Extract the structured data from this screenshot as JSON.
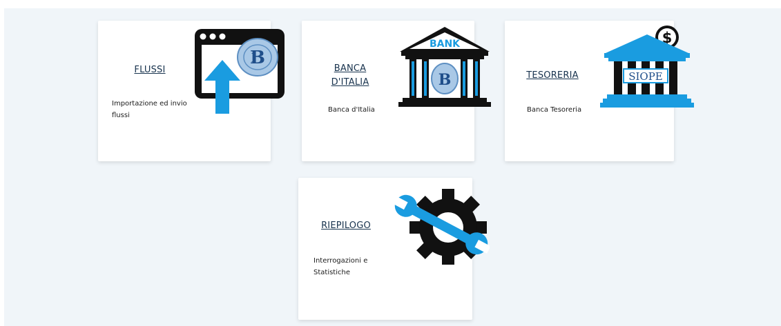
{
  "colors": {
    "accent": "#1a9ce0",
    "icon_dark": "#111111",
    "title": "#17324d",
    "background": "#f0f5f9"
  },
  "cards": [
    {
      "title": "FLUSSI",
      "description": "Importazione ed invio flussi",
      "icon": "upload-window-icon"
    },
    {
      "title": "BANCA D'ITALIA",
      "description": "Banca d'Italia",
      "icon": "bank-building-icon",
      "icon_text": "BANK"
    },
    {
      "title": "TESORERIA",
      "description": "Banca Tesoreria",
      "icon": "treasury-building-icon",
      "icon_text": "SIOPE"
    },
    {
      "title": "RIEPILOGO",
      "description": "Interrogazioni e Statistiche",
      "icon": "gear-wrench-icon"
    }
  ]
}
